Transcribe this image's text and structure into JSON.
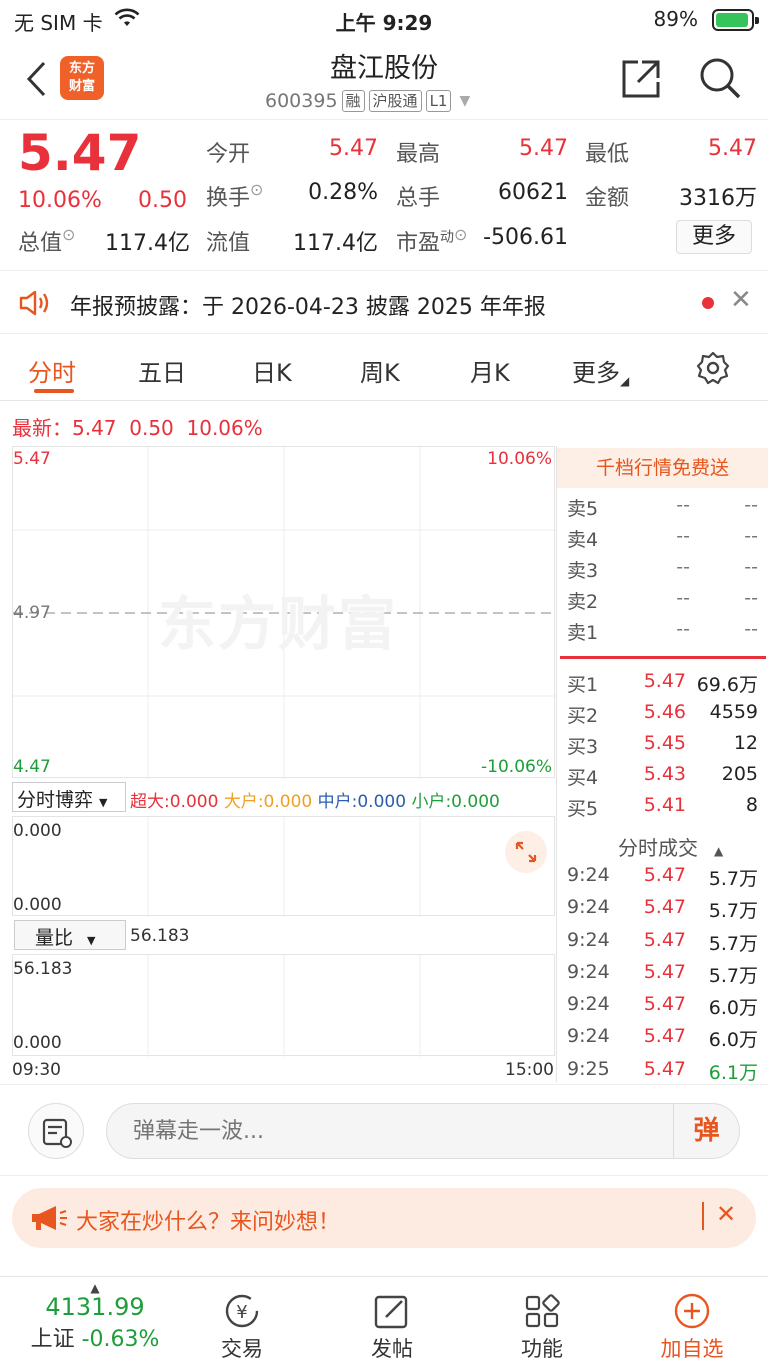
{
  "status": {
    "carrier": "无 SIM 卡",
    "time": "上午 9:29",
    "battery": "89%"
  },
  "header": {
    "logo_text": "东方财富",
    "title": "盘江股份",
    "code": "600395",
    "tags": [
      "融",
      "沪股通",
      "L1"
    ]
  },
  "quote": {
    "price": "5.47",
    "pct": "10.06%",
    "chg": "0.50",
    "rows": [
      [
        {
          "k": "今开",
          "v": "5.47",
          "red": true
        },
        {
          "k": "最高",
          "v": "5.47",
          "red": true
        },
        {
          "k": "最低",
          "v": "5.47",
          "red": true
        }
      ],
      [
        {
          "k": "换手",
          "v": "0.28%",
          "red": false
        },
        {
          "k": "总手",
          "v": "60621",
          "red": false
        },
        {
          "k": "金额",
          "v": "3316万",
          "red": false
        }
      ],
      [
        {
          "k": "总值",
          "v": "117.4亿"
        },
        {
          "k": "流值",
          "v": "117.4亿"
        },
        {
          "k": "市盈",
          "sup": "动",
          "v": "-506.61"
        }
      ]
    ],
    "more": "更多"
  },
  "notice": {
    "text": "年报预披露：于 2026-04-23 披露 2025 年年报"
  },
  "tabs": [
    "分时",
    "五日",
    "日K",
    "周K",
    "月K",
    "更多"
  ],
  "latest": {
    "label": "最新：",
    "price": "5.47",
    "chg": "0.50",
    "pct": "10.06%"
  },
  "chart": {
    "y_top": "5.47",
    "y_mid": "4.97",
    "y_bot": "4.47",
    "pct_top": "10.06%",
    "pct_bot": "-10.06%",
    "watermark": "东方财富",
    "fund_label": "分时博弈",
    "fund_items": [
      {
        "k": "超大",
        "v": "0.000",
        "color": "#e8313a"
      },
      {
        "k": "大户",
        "v": "0.000",
        "color": "#f0a020"
      },
      {
        "k": "中户",
        "v": "0.000",
        "color": "#2a5db0"
      },
      {
        "k": "小户",
        "v": "0.000",
        "color": "#1e9e3a"
      }
    ],
    "fund_top": "0.000",
    "fund_bot": "0.000",
    "lb_label": "量比",
    "lb_value": "56.183",
    "lb_top": "56.183",
    "lb_bot": "0.000",
    "t_start": "09:30",
    "t_end": "15:00"
  },
  "orderbook": {
    "promo": "千档行情免费送",
    "sells": [
      {
        "l": "卖5",
        "p": "--",
        "v": "--"
      },
      {
        "l": "卖4",
        "p": "--",
        "v": "--"
      },
      {
        "l": "卖3",
        "p": "--",
        "v": "--"
      },
      {
        "l": "卖2",
        "p": "--",
        "v": "--"
      },
      {
        "l": "卖1",
        "p": "--",
        "v": "--"
      }
    ],
    "buys": [
      {
        "l": "买1",
        "p": "5.47",
        "v": "69.6万"
      },
      {
        "l": "买2",
        "p": "5.46",
        "v": "4559"
      },
      {
        "l": "买3",
        "p": "5.45",
        "v": "12"
      },
      {
        "l": "买4",
        "p": "5.43",
        "v": "205"
      },
      {
        "l": "买5",
        "p": "5.41",
        "v": "8"
      }
    ],
    "trades_title": "分时成交",
    "trades": [
      {
        "t": "9:24",
        "p": "5.47",
        "v": "5.7万"
      },
      {
        "t": "9:24",
        "p": "5.47",
        "v": "5.7万"
      },
      {
        "t": "9:24",
        "p": "5.47",
        "v": "5.7万"
      },
      {
        "t": "9:24",
        "p": "5.47",
        "v": "5.7万"
      },
      {
        "t": "9:24",
        "p": "5.47",
        "v": "6.0万"
      },
      {
        "t": "9:24",
        "p": "5.47",
        "v": "6.0万"
      },
      {
        "t": "9:25",
        "p": "5.47",
        "v": "6.1万",
        "green": true
      }
    ]
  },
  "comment": {
    "placeholder": "弹幕走一波...",
    "btn": "弹"
  },
  "ask": {
    "text": "大家在炒什么？来问妙想！"
  },
  "nav": {
    "index_value": "4131.99",
    "index_name": "上证",
    "index_pct": "-0.63%",
    "items": [
      "交易",
      "发帖",
      "功能",
      "加自选"
    ]
  }
}
